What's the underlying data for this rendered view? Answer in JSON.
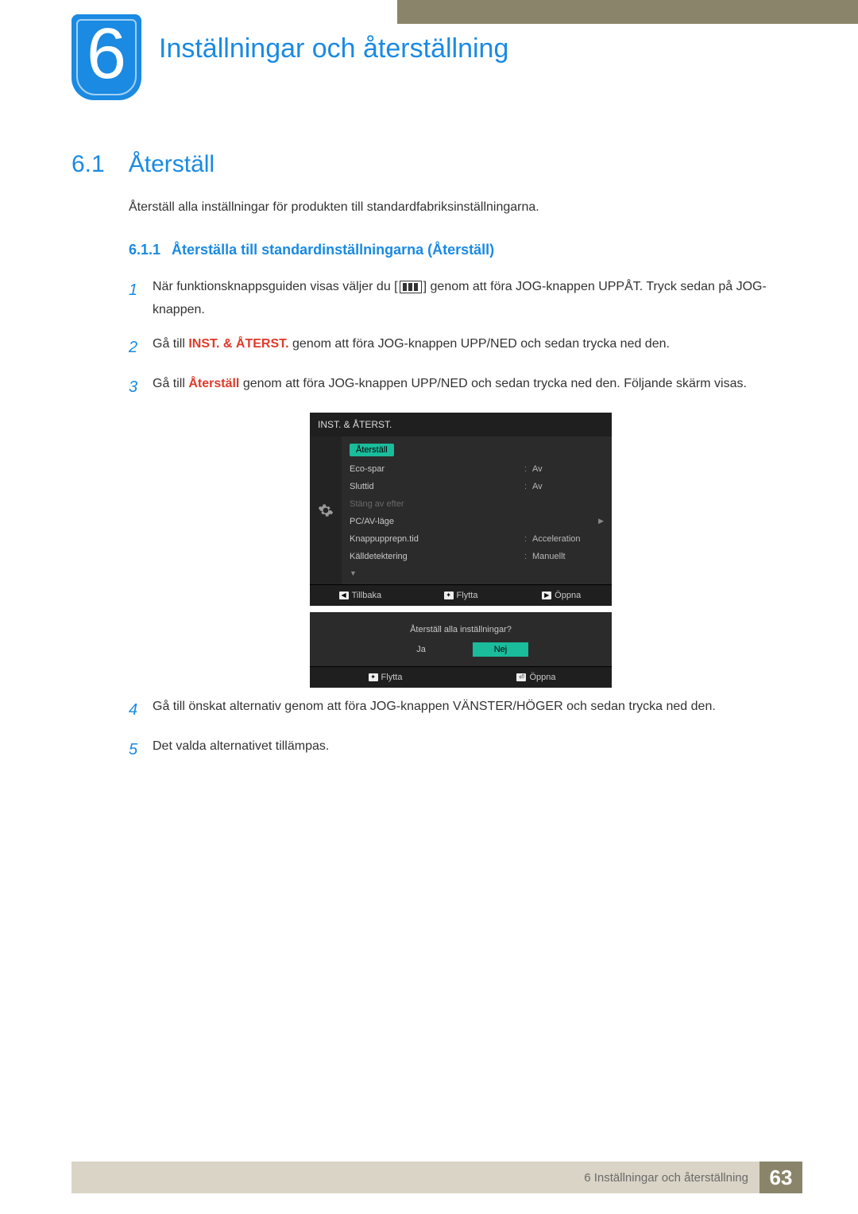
{
  "chapter": {
    "number": "6",
    "title": "Inställningar och återställning"
  },
  "section": {
    "number": "6.1",
    "title": "Återställ"
  },
  "intro": "Återställ alla inställningar för produkten till standardfabriksinställningarna.",
  "subsection": {
    "number": "6.1.1",
    "title": "Återställa till standardinställningarna (Återställ)"
  },
  "steps": {
    "s1a": "När funktionsknappsguiden visas väljer du [",
    "s1b": "] genom att föra JOG-knappen UPPÅT. Tryck sedan på JOG-knappen.",
    "s2a": "Gå till ",
    "s2red": "INST. & ÅTERST.",
    "s2b": " genom att föra JOG-knappen UPP/NED och sedan trycka ned den.",
    "s3a": "Gå till ",
    "s3red": "Återställ",
    "s3b": " genom att föra JOG-knappen UPP/NED och sedan trycka ned den. Följande skärm visas.",
    "s4": "Gå till önskat alternativ genom att föra JOG-knappen VÄNSTER/HÖGER och sedan trycka ned den.",
    "s5": "Det valda alternativet tillämpas."
  },
  "osd": {
    "title": "INST. & ÅTERST.",
    "items": [
      {
        "label": "Återställ",
        "value": "",
        "sel": true
      },
      {
        "label": "Eco-spar",
        "value": "Av"
      },
      {
        "label": "Sluttid",
        "value": "Av"
      },
      {
        "label": "Stäng av efter",
        "value": "",
        "dim": true
      },
      {
        "label": "PC/AV-läge",
        "value": "",
        "caret": true
      },
      {
        "label": "Knappupprepn.tid",
        "value": "Acceleration"
      },
      {
        "label": "Källdetektering",
        "value": "Manuellt"
      }
    ],
    "nav": {
      "back": "Tillbaka",
      "move": "Flytta",
      "open": "Öppna"
    }
  },
  "dialog": {
    "question": "Återställ alla inställningar?",
    "yes": "Ja",
    "no": "Nej"
  },
  "footer": {
    "chapter": "6 Inställningar och återställning",
    "page": "63"
  }
}
